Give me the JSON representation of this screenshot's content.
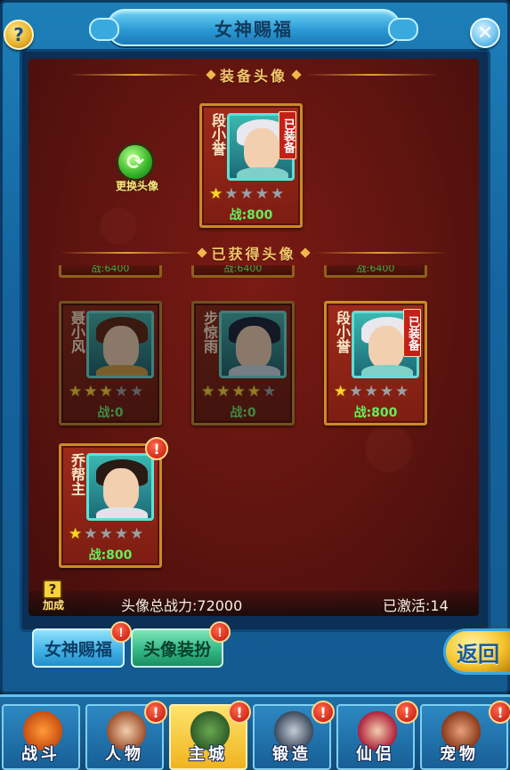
{
  "window": {
    "title": "女神赐福",
    "help_glyph": "?",
    "close_glyph": "✕"
  },
  "equipped_section": {
    "heading": "装备头像",
    "change_label": "更换头像",
    "change_glyph": "⟳",
    "card": {
      "name": "段小誉",
      "equipped_tag": "已装备",
      "stars": 1,
      "max_stars": 5,
      "power": "战:800"
    }
  },
  "obtained_section": {
    "heading": "已获得头像",
    "partial_row_power": "战:6400",
    "cards": [
      {
        "name": "聂小风",
        "stars": 3,
        "max_stars": 5,
        "power": "战:0",
        "dimmed": true,
        "equipped_tag": "",
        "alert": ""
      },
      {
        "name": "步惊雨",
        "stars": 4,
        "max_stars": 5,
        "power": "战:0",
        "dimmed": true,
        "equipped_tag": "",
        "alert": ""
      },
      {
        "name": "段小誉",
        "stars": 1,
        "max_stars": 5,
        "power": "战:800",
        "dimmed": false,
        "equipped_tag": "已装备",
        "alert": ""
      },
      {
        "name": "乔帮主",
        "stars": 1,
        "max_stars": 5,
        "power": "战:800",
        "dimmed": false,
        "equipped_tag": "",
        "alert": "!"
      }
    ]
  },
  "footer": {
    "bonus_glyph": "?",
    "bonus_label": "加成",
    "total_power": "头像总战力:72000",
    "activated": "已激活:14"
  },
  "tabs": [
    {
      "label": "女神赐福",
      "alert": "!"
    },
    {
      "label": "头像装扮",
      "alert": "!"
    }
  ],
  "return_label": "返回",
  "bottom_nav": [
    {
      "label": "战斗",
      "alert": ""
    },
    {
      "label": "人物",
      "alert": "!"
    },
    {
      "label": "主城",
      "alert": "!"
    },
    {
      "label": "锻造",
      "alert": "!"
    },
    {
      "label": "仙侣",
      "alert": "!"
    },
    {
      "label": "宠物",
      "alert": "!"
    }
  ],
  "colors": {
    "panel_red": "#5e140f",
    "card_border": "#c98b2a",
    "power_green": "#5ff05c",
    "star_on": "#ffd52a",
    "star_off": "#9aa0a6",
    "frame_blue": "#1565a0"
  }
}
